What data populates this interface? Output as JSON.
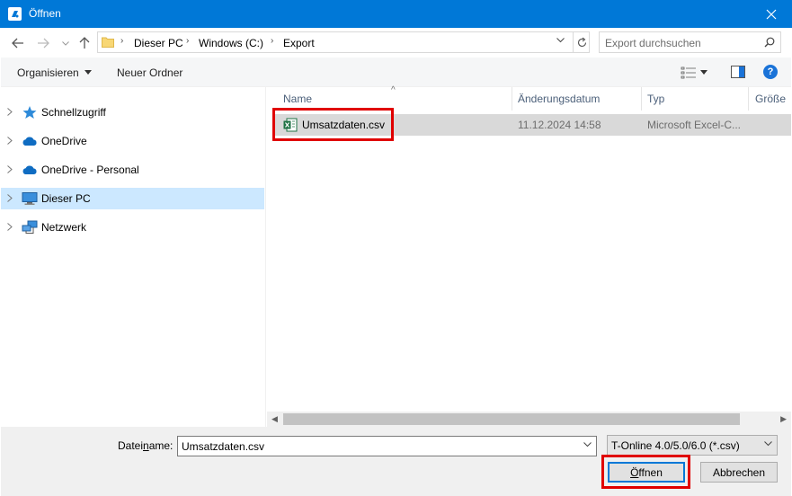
{
  "window": {
    "title": "Öffnen"
  },
  "breadcrumb": [
    "Dieser PC",
    "Windows (C:)",
    "Export"
  ],
  "search": {
    "placeholder": "Export durchsuchen"
  },
  "toolbar": {
    "organize_label": "Organisieren",
    "new_folder_label": "Neuer Ordner",
    "help_label": "?"
  },
  "sidebar": {
    "items": [
      {
        "label": "Schnellzugriff",
        "icon": "star-icon"
      },
      {
        "label": "OneDrive",
        "icon": "cloud-icon"
      },
      {
        "label": "OneDrive - Personal",
        "icon": "cloud-icon"
      },
      {
        "label": "Dieser PC",
        "icon": "computer-icon",
        "selected": true
      },
      {
        "label": "Netzwerk",
        "icon": "network-icon"
      }
    ]
  },
  "columns": [
    "Name",
    "Änderungsdatum",
    "Typ",
    "Größe"
  ],
  "files": [
    {
      "name": "Umsatzdaten.csv",
      "modified": "11.12.2024 14:58",
      "type": "Microsoft Excel-C...",
      "icon": "excel-csv-icon"
    }
  ],
  "bottom": {
    "filename_label_pre": "Datei",
    "filename_label_accel": "n",
    "filename_label_post": "ame:",
    "filename_value": "Umsatzdaten.csv",
    "filter_value": "T-Online 4.0/5.0/6.0 (*.csv)",
    "open_label_accel": "Ö",
    "open_label_rest": "ffnen",
    "cancel_label": "Abbrechen"
  },
  "colors": {
    "titlebar": "#0078d7",
    "selection": "#cce8ff",
    "highlight_box": "#e00000"
  }
}
